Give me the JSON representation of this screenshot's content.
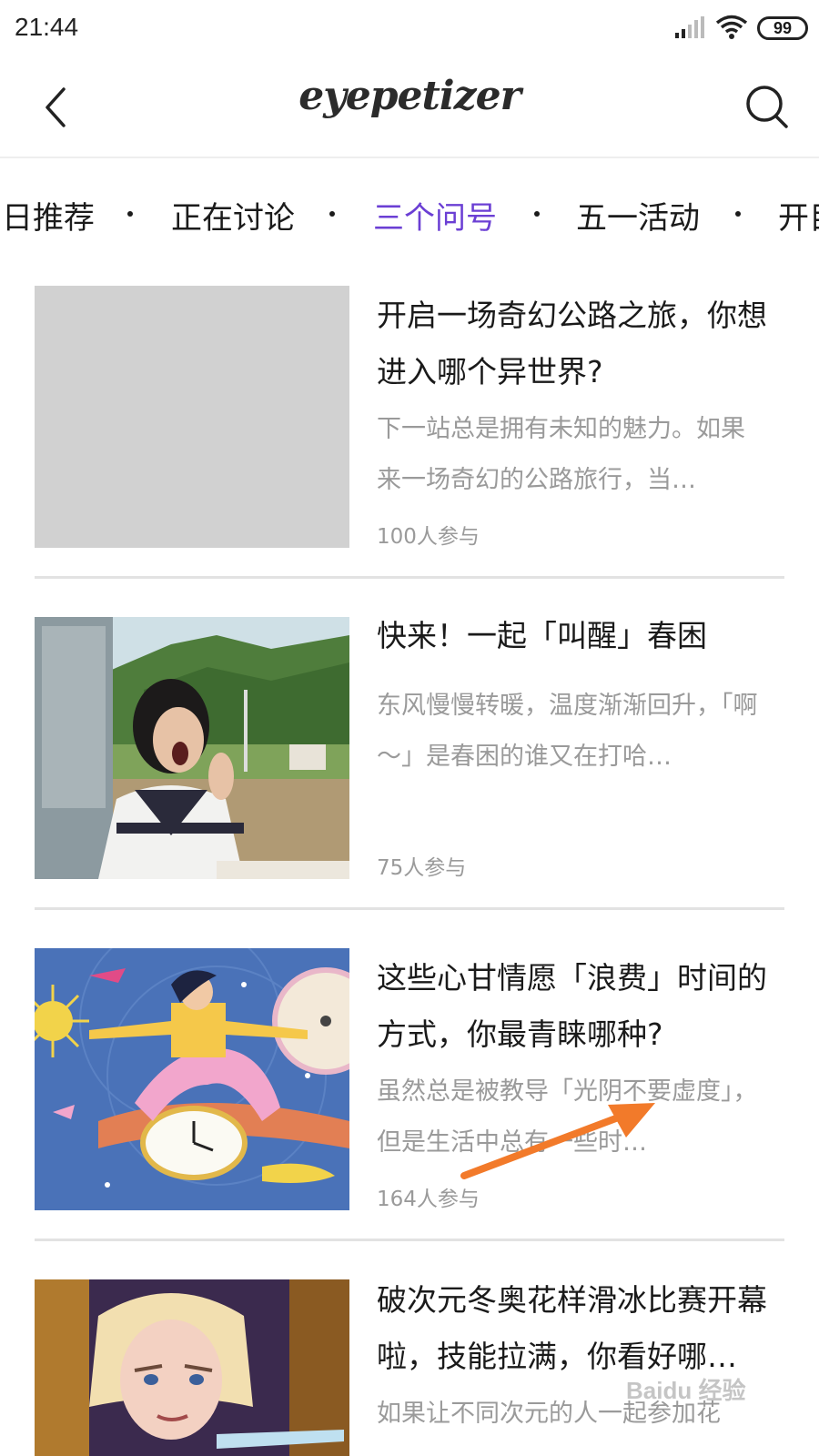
{
  "status_bar": {
    "time": "21:44",
    "battery": "99"
  },
  "app_bar": {
    "title": "eyepetizer",
    "back_icon": "chevron-left-icon",
    "search_icon": "search-icon"
  },
  "tabs": [
    {
      "label": "日推荐",
      "active": false
    },
    {
      "label": "正在讨论",
      "active": false
    },
    {
      "label": "三个问号",
      "active": true
    },
    {
      "label": "五一活动",
      "active": false
    },
    {
      "label": "开目",
      "active": false
    }
  ],
  "colors": {
    "accent": "#6b3fd4",
    "text_primary": "#1a1a1a",
    "text_secondary": "#9a9a9a",
    "divider": "#e2e2e2",
    "annotation_arrow": "#f27a2a"
  },
  "feed": [
    {
      "title": "开启一场奇幻公路之旅，你想进入哪个异世界?",
      "description": "下一站总是拥有未知的魅力。如果来一场奇幻的公路旅行，当…",
      "participants": "100人参与",
      "thumbnail": "placeholder-gray"
    },
    {
      "title": "快来！一起「叫醒」春困",
      "description": "东风慢慢转暖，温度渐渐回升，「啊～」是春困的谁又在打哈…",
      "participants": "75人参与",
      "thumbnail": "yawning-girl-by-window"
    },
    {
      "title": "这些心甘情愿「浪费」时间的方式，你最青睐哪种?",
      "description": "虽然总是被教导「光阴不要虚度」，但是生活中总有一些时…",
      "participants": "164人参与",
      "thumbnail": "illustration-woman-on-watch"
    },
    {
      "title": "破次元冬奥花样滑冰比赛开幕啦，技能拉满，你看好哪…",
      "description": "如果让不同次元的人一起参加花",
      "participants": "",
      "thumbnail": "animated-ice-queen"
    }
  ],
  "watermark": "Baidu 经验"
}
